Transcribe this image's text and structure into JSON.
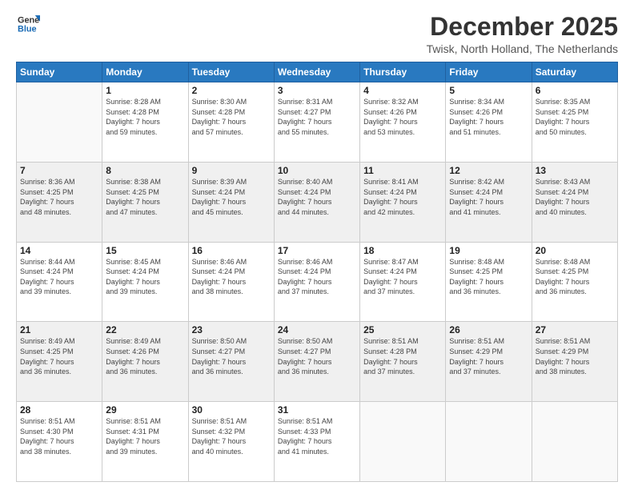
{
  "logo": {
    "line1": "General",
    "line2": "Blue"
  },
  "title": "December 2025",
  "location": "Twisk, North Holland, The Netherlands",
  "days_of_week": [
    "Sunday",
    "Monday",
    "Tuesday",
    "Wednesday",
    "Thursday",
    "Friday",
    "Saturday"
  ],
  "weeks": [
    [
      {
        "day": "",
        "info": ""
      },
      {
        "day": "1",
        "info": "Sunrise: 8:28 AM\nSunset: 4:28 PM\nDaylight: 7 hours\nand 59 minutes."
      },
      {
        "day": "2",
        "info": "Sunrise: 8:30 AM\nSunset: 4:28 PM\nDaylight: 7 hours\nand 57 minutes."
      },
      {
        "day": "3",
        "info": "Sunrise: 8:31 AM\nSunset: 4:27 PM\nDaylight: 7 hours\nand 55 minutes."
      },
      {
        "day": "4",
        "info": "Sunrise: 8:32 AM\nSunset: 4:26 PM\nDaylight: 7 hours\nand 53 minutes."
      },
      {
        "day": "5",
        "info": "Sunrise: 8:34 AM\nSunset: 4:26 PM\nDaylight: 7 hours\nand 51 minutes."
      },
      {
        "day": "6",
        "info": "Sunrise: 8:35 AM\nSunset: 4:25 PM\nDaylight: 7 hours\nand 50 minutes."
      }
    ],
    [
      {
        "day": "7",
        "info": "Sunrise: 8:36 AM\nSunset: 4:25 PM\nDaylight: 7 hours\nand 48 minutes."
      },
      {
        "day": "8",
        "info": "Sunrise: 8:38 AM\nSunset: 4:25 PM\nDaylight: 7 hours\nand 47 minutes."
      },
      {
        "day": "9",
        "info": "Sunrise: 8:39 AM\nSunset: 4:24 PM\nDaylight: 7 hours\nand 45 minutes."
      },
      {
        "day": "10",
        "info": "Sunrise: 8:40 AM\nSunset: 4:24 PM\nDaylight: 7 hours\nand 44 minutes."
      },
      {
        "day": "11",
        "info": "Sunrise: 8:41 AM\nSunset: 4:24 PM\nDaylight: 7 hours\nand 42 minutes."
      },
      {
        "day": "12",
        "info": "Sunrise: 8:42 AM\nSunset: 4:24 PM\nDaylight: 7 hours\nand 41 minutes."
      },
      {
        "day": "13",
        "info": "Sunrise: 8:43 AM\nSunset: 4:24 PM\nDaylight: 7 hours\nand 40 minutes."
      }
    ],
    [
      {
        "day": "14",
        "info": "Sunrise: 8:44 AM\nSunset: 4:24 PM\nDaylight: 7 hours\nand 39 minutes."
      },
      {
        "day": "15",
        "info": "Sunrise: 8:45 AM\nSunset: 4:24 PM\nDaylight: 7 hours\nand 39 minutes."
      },
      {
        "day": "16",
        "info": "Sunrise: 8:46 AM\nSunset: 4:24 PM\nDaylight: 7 hours\nand 38 minutes."
      },
      {
        "day": "17",
        "info": "Sunrise: 8:46 AM\nSunset: 4:24 PM\nDaylight: 7 hours\nand 37 minutes."
      },
      {
        "day": "18",
        "info": "Sunrise: 8:47 AM\nSunset: 4:24 PM\nDaylight: 7 hours\nand 37 minutes."
      },
      {
        "day": "19",
        "info": "Sunrise: 8:48 AM\nSunset: 4:25 PM\nDaylight: 7 hours\nand 36 minutes."
      },
      {
        "day": "20",
        "info": "Sunrise: 8:48 AM\nSunset: 4:25 PM\nDaylight: 7 hours\nand 36 minutes."
      }
    ],
    [
      {
        "day": "21",
        "info": "Sunrise: 8:49 AM\nSunset: 4:25 PM\nDaylight: 7 hours\nand 36 minutes."
      },
      {
        "day": "22",
        "info": "Sunrise: 8:49 AM\nSunset: 4:26 PM\nDaylight: 7 hours\nand 36 minutes."
      },
      {
        "day": "23",
        "info": "Sunrise: 8:50 AM\nSunset: 4:27 PM\nDaylight: 7 hours\nand 36 minutes."
      },
      {
        "day": "24",
        "info": "Sunrise: 8:50 AM\nSunset: 4:27 PM\nDaylight: 7 hours\nand 36 minutes."
      },
      {
        "day": "25",
        "info": "Sunrise: 8:51 AM\nSunset: 4:28 PM\nDaylight: 7 hours\nand 37 minutes."
      },
      {
        "day": "26",
        "info": "Sunrise: 8:51 AM\nSunset: 4:29 PM\nDaylight: 7 hours\nand 37 minutes."
      },
      {
        "day": "27",
        "info": "Sunrise: 8:51 AM\nSunset: 4:29 PM\nDaylight: 7 hours\nand 38 minutes."
      }
    ],
    [
      {
        "day": "28",
        "info": "Sunrise: 8:51 AM\nSunset: 4:30 PM\nDaylight: 7 hours\nand 38 minutes."
      },
      {
        "day": "29",
        "info": "Sunrise: 8:51 AM\nSunset: 4:31 PM\nDaylight: 7 hours\nand 39 minutes."
      },
      {
        "day": "30",
        "info": "Sunrise: 8:51 AM\nSunset: 4:32 PM\nDaylight: 7 hours\nand 40 minutes."
      },
      {
        "day": "31",
        "info": "Sunrise: 8:51 AM\nSunset: 4:33 PM\nDaylight: 7 hours\nand 41 minutes."
      },
      {
        "day": "",
        "info": ""
      },
      {
        "day": "",
        "info": ""
      },
      {
        "day": "",
        "info": ""
      }
    ]
  ]
}
